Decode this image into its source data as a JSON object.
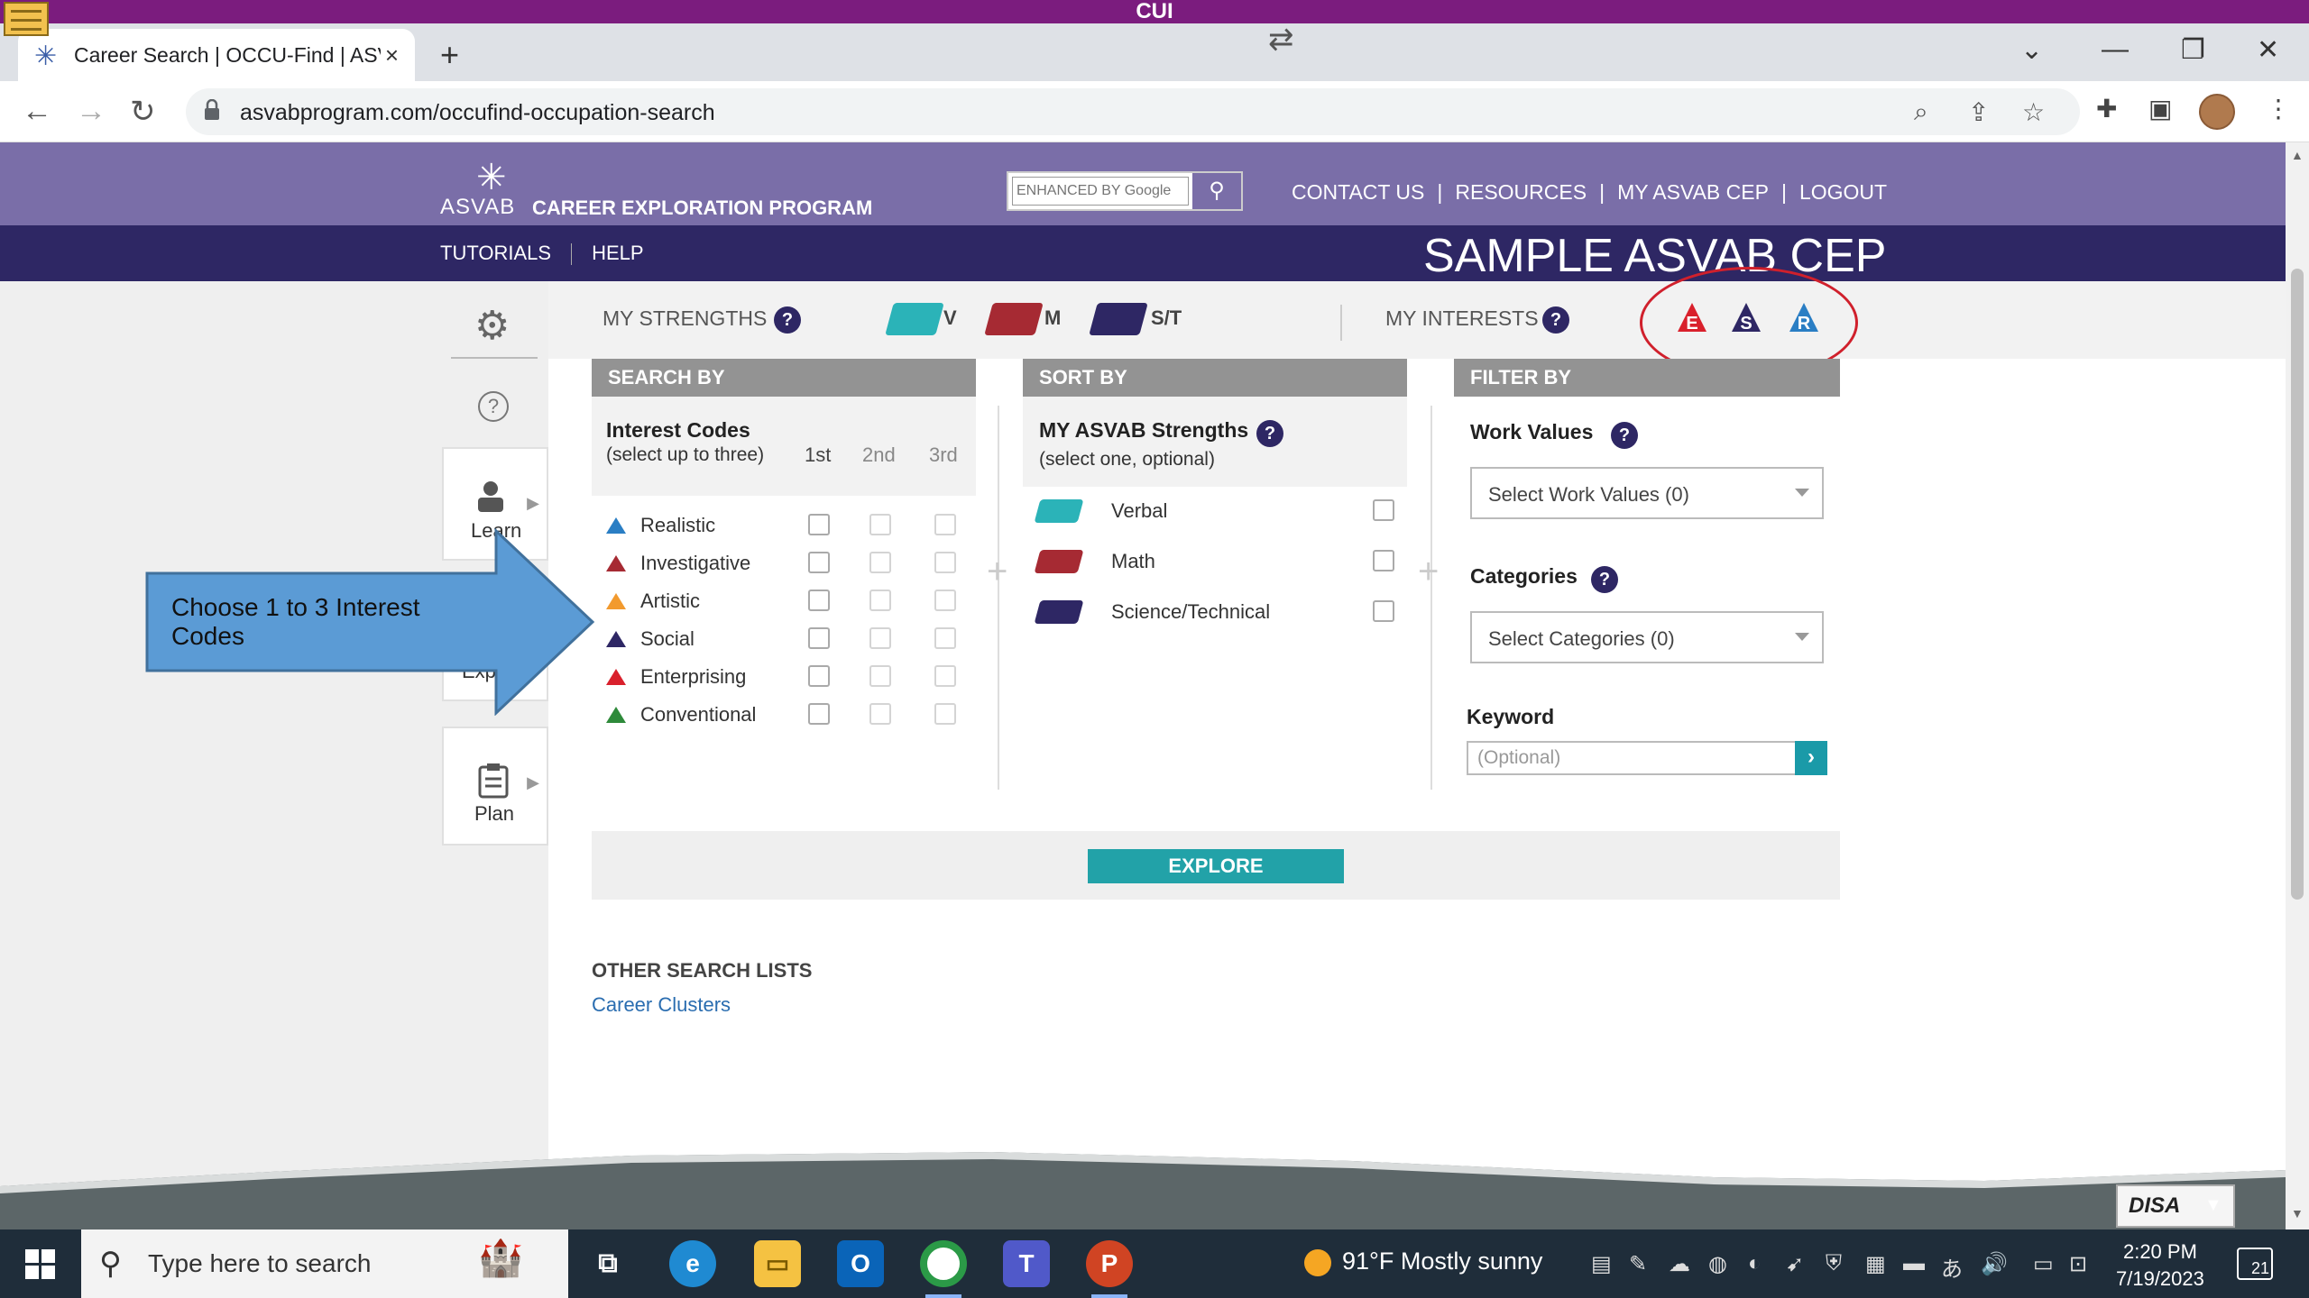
{
  "banner": {
    "label": "CUI"
  },
  "browser": {
    "tab_title": "Career Search | OCCU-Find | ASVA",
    "tab_close": "×",
    "new_tab": "+",
    "url": "asvabprogram.com/occufind-occupation-search"
  },
  "site": {
    "logo_asvab": "ASVAB",
    "logo_program": "CAREER EXPLORATION PROGRAM",
    "search_placeholder": "ENHANCED BY Google",
    "top_links": [
      "CONTACT US",
      "RESOURCES",
      "MY ASVAB CEP",
      "LOGOUT"
    ],
    "nav_links": [
      "TUTORIALS",
      "HELP"
    ],
    "page_title": "SAMPLE ASVAB CEP"
  },
  "sidebar": {
    "items": [
      {
        "label": "Learn"
      },
      {
        "label": "Exp"
      },
      {
        "label": "Plan"
      }
    ]
  },
  "strengths_bar": {
    "strengths_label": "MY STRENGTHS",
    "help": "?",
    "books": [
      {
        "letter": "V",
        "color": "#2bb3b8"
      },
      {
        "letter": "M",
        "color": "#a62a33"
      },
      {
        "letter": "S/T",
        "color": "#2e2764"
      }
    ],
    "interests_label": "MY INTERESTS",
    "interest_icons": [
      {
        "letter": "E",
        "color": "#d9202c"
      },
      {
        "letter": "S",
        "color": "#2e2764"
      },
      {
        "letter": "R",
        "color": "#2a7ec4"
      }
    ]
  },
  "search_by": {
    "header": "SEARCH BY",
    "title": "Interest Codes",
    "subtitle": "(select up to three)",
    "columns": [
      "1st",
      "2nd",
      "3rd"
    ],
    "codes": [
      {
        "name": "Realistic",
        "color": "#2a7ec4"
      },
      {
        "name": "Investigative",
        "color": "#a62a33"
      },
      {
        "name": "Artistic",
        "color": "#f29a2e"
      },
      {
        "name": "Social",
        "color": "#2e2764"
      },
      {
        "name": "Enterprising",
        "color": "#d9202c"
      },
      {
        "name": "Conventional",
        "color": "#2e8a3a"
      }
    ]
  },
  "sort_by": {
    "header": "SORT BY",
    "title": "MY ASVAB Strengths",
    "subtitle": "(select one, optional)",
    "items": [
      {
        "name": "Verbal",
        "color": "#2bb3b8"
      },
      {
        "name": "Math",
        "color": "#a62a33"
      },
      {
        "name": "Science/Technical",
        "color": "#2e2764"
      }
    ]
  },
  "filter_by": {
    "header": "FILTER BY",
    "work_values_label": "Work Values",
    "work_values_select": "Select Work Values (0)",
    "categories_label": "Categories",
    "categories_select": "Select Categories (0)",
    "keyword_label": "Keyword",
    "keyword_placeholder": "(Optional)"
  },
  "explore_button": "EXPLORE",
  "other_lists": {
    "header": "OTHER SEARCH LISTS",
    "link": "Career Clusters"
  },
  "callout": {
    "text": "Choose 1 to 3 Interest Codes"
  },
  "disa": {
    "label": "DISA"
  },
  "taskbar": {
    "search_placeholder": "Type here to search",
    "weather": "91°F  Mostly sunny",
    "time": "2:20 PM",
    "date": "7/19/2023",
    "notifications": "21"
  }
}
